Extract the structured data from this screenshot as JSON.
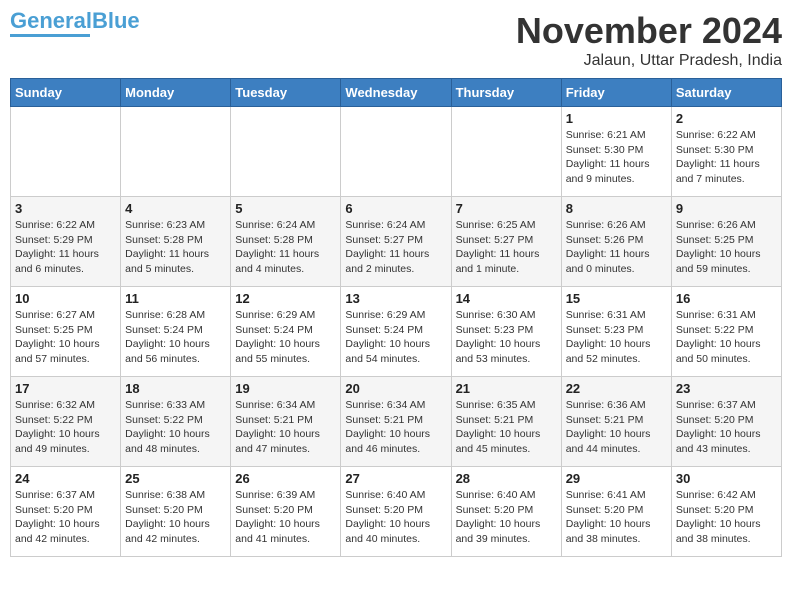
{
  "logo": {
    "part1": "General",
    "part2": "Blue"
  },
  "title": "November 2024",
  "subtitle": "Jalaun, Uttar Pradesh, India",
  "weekdays": [
    "Sunday",
    "Monday",
    "Tuesday",
    "Wednesday",
    "Thursday",
    "Friday",
    "Saturday"
  ],
  "weeks": [
    [
      {
        "day": "",
        "info": ""
      },
      {
        "day": "",
        "info": ""
      },
      {
        "day": "",
        "info": ""
      },
      {
        "day": "",
        "info": ""
      },
      {
        "day": "",
        "info": ""
      },
      {
        "day": "1",
        "info": "Sunrise: 6:21 AM\nSunset: 5:30 PM\nDaylight: 11 hours and 9 minutes."
      },
      {
        "day": "2",
        "info": "Sunrise: 6:22 AM\nSunset: 5:30 PM\nDaylight: 11 hours and 7 minutes."
      }
    ],
    [
      {
        "day": "3",
        "info": "Sunrise: 6:22 AM\nSunset: 5:29 PM\nDaylight: 11 hours and 6 minutes."
      },
      {
        "day": "4",
        "info": "Sunrise: 6:23 AM\nSunset: 5:28 PM\nDaylight: 11 hours and 5 minutes."
      },
      {
        "day": "5",
        "info": "Sunrise: 6:24 AM\nSunset: 5:28 PM\nDaylight: 11 hours and 4 minutes."
      },
      {
        "day": "6",
        "info": "Sunrise: 6:24 AM\nSunset: 5:27 PM\nDaylight: 11 hours and 2 minutes."
      },
      {
        "day": "7",
        "info": "Sunrise: 6:25 AM\nSunset: 5:27 PM\nDaylight: 11 hours and 1 minute."
      },
      {
        "day": "8",
        "info": "Sunrise: 6:26 AM\nSunset: 5:26 PM\nDaylight: 11 hours and 0 minutes."
      },
      {
        "day": "9",
        "info": "Sunrise: 6:26 AM\nSunset: 5:25 PM\nDaylight: 10 hours and 59 minutes."
      }
    ],
    [
      {
        "day": "10",
        "info": "Sunrise: 6:27 AM\nSunset: 5:25 PM\nDaylight: 10 hours and 57 minutes."
      },
      {
        "day": "11",
        "info": "Sunrise: 6:28 AM\nSunset: 5:24 PM\nDaylight: 10 hours and 56 minutes."
      },
      {
        "day": "12",
        "info": "Sunrise: 6:29 AM\nSunset: 5:24 PM\nDaylight: 10 hours and 55 minutes."
      },
      {
        "day": "13",
        "info": "Sunrise: 6:29 AM\nSunset: 5:24 PM\nDaylight: 10 hours and 54 minutes."
      },
      {
        "day": "14",
        "info": "Sunrise: 6:30 AM\nSunset: 5:23 PM\nDaylight: 10 hours and 53 minutes."
      },
      {
        "day": "15",
        "info": "Sunrise: 6:31 AM\nSunset: 5:23 PM\nDaylight: 10 hours and 52 minutes."
      },
      {
        "day": "16",
        "info": "Sunrise: 6:31 AM\nSunset: 5:22 PM\nDaylight: 10 hours and 50 minutes."
      }
    ],
    [
      {
        "day": "17",
        "info": "Sunrise: 6:32 AM\nSunset: 5:22 PM\nDaylight: 10 hours and 49 minutes."
      },
      {
        "day": "18",
        "info": "Sunrise: 6:33 AM\nSunset: 5:22 PM\nDaylight: 10 hours and 48 minutes."
      },
      {
        "day": "19",
        "info": "Sunrise: 6:34 AM\nSunset: 5:21 PM\nDaylight: 10 hours and 47 minutes."
      },
      {
        "day": "20",
        "info": "Sunrise: 6:34 AM\nSunset: 5:21 PM\nDaylight: 10 hours and 46 minutes."
      },
      {
        "day": "21",
        "info": "Sunrise: 6:35 AM\nSunset: 5:21 PM\nDaylight: 10 hours and 45 minutes."
      },
      {
        "day": "22",
        "info": "Sunrise: 6:36 AM\nSunset: 5:21 PM\nDaylight: 10 hours and 44 minutes."
      },
      {
        "day": "23",
        "info": "Sunrise: 6:37 AM\nSunset: 5:20 PM\nDaylight: 10 hours and 43 minutes."
      }
    ],
    [
      {
        "day": "24",
        "info": "Sunrise: 6:37 AM\nSunset: 5:20 PM\nDaylight: 10 hours and 42 minutes."
      },
      {
        "day": "25",
        "info": "Sunrise: 6:38 AM\nSunset: 5:20 PM\nDaylight: 10 hours and 42 minutes."
      },
      {
        "day": "26",
        "info": "Sunrise: 6:39 AM\nSunset: 5:20 PM\nDaylight: 10 hours and 41 minutes."
      },
      {
        "day": "27",
        "info": "Sunrise: 6:40 AM\nSunset: 5:20 PM\nDaylight: 10 hours and 40 minutes."
      },
      {
        "day": "28",
        "info": "Sunrise: 6:40 AM\nSunset: 5:20 PM\nDaylight: 10 hours and 39 minutes."
      },
      {
        "day": "29",
        "info": "Sunrise: 6:41 AM\nSunset: 5:20 PM\nDaylight: 10 hours and 38 minutes."
      },
      {
        "day": "30",
        "info": "Sunrise: 6:42 AM\nSunset: 5:20 PM\nDaylight: 10 hours and 38 minutes."
      }
    ]
  ]
}
